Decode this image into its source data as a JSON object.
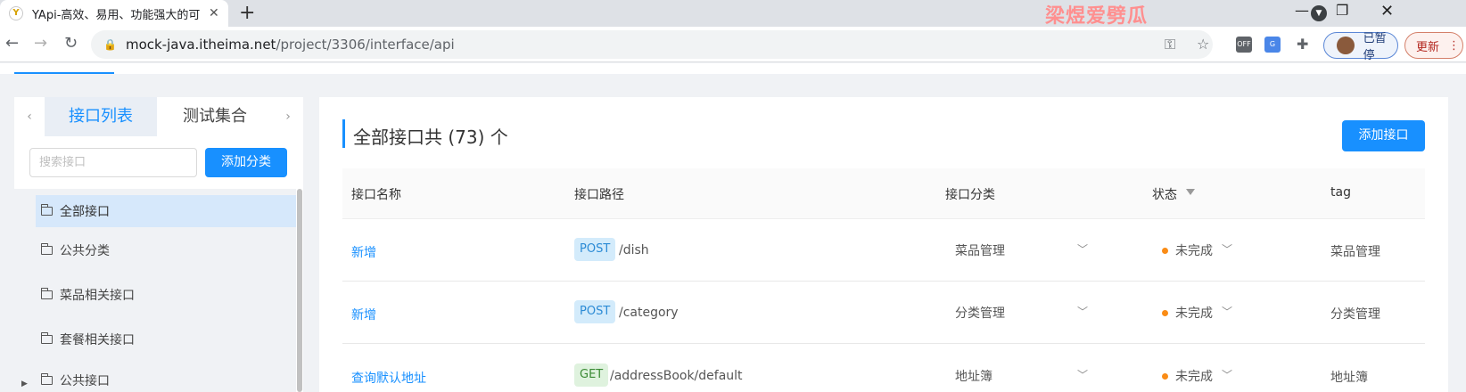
{
  "browser": {
    "tab_title": "YApi-高效、易用、功能强大的可",
    "tab_close": "✕",
    "new_tab": "+",
    "watermark": "梁煜爱劈瓜",
    "url_host": "mock-java.itheima.net",
    "url_path": "/project/3306/interface/api",
    "ext_off_label": "OFF",
    "profile_label": "已暂停",
    "update_label": "更新"
  },
  "left_panel": {
    "tab_prev": "‹",
    "tab_next": "›",
    "tabs": [
      {
        "label": "接口列表",
        "active": true
      },
      {
        "label": "测试集合",
        "active": false
      }
    ],
    "search_placeholder": "搜索接口",
    "add_category_label": "添加分类",
    "categories": [
      {
        "label": "全部接口",
        "selected": true
      },
      {
        "label": "公共分类",
        "selected": false
      },
      {
        "label": "菜品相关接口",
        "selected": false
      },
      {
        "label": "套餐相关接口",
        "selected": false
      },
      {
        "label": "公共接口",
        "selected": false
      }
    ]
  },
  "main": {
    "title": "全部接口共 (73) 个",
    "add_api_label": "添加接口",
    "columns": [
      "接口名称",
      "接口路径",
      "接口分类",
      "状态",
      "tag"
    ],
    "rows": [
      {
        "name": "新增",
        "method": "POST",
        "path": "/dish",
        "category": "菜品管理",
        "status": "未完成",
        "tag": "菜品管理"
      },
      {
        "name": "新增",
        "method": "POST",
        "path": "/category",
        "category": "分类管理",
        "status": "未完成",
        "tag": "分类管理"
      },
      {
        "name": "查询默认地址",
        "method": "GET",
        "path": "/addressBook/default",
        "category": "地址簿",
        "status": "未完成",
        "tag": "地址簿"
      }
    ]
  },
  "colors": {
    "accent": "#1890ff",
    "status_dot": "#fa8c16",
    "post_bg": "#d3ebfb",
    "get_bg": "#dff2de"
  }
}
